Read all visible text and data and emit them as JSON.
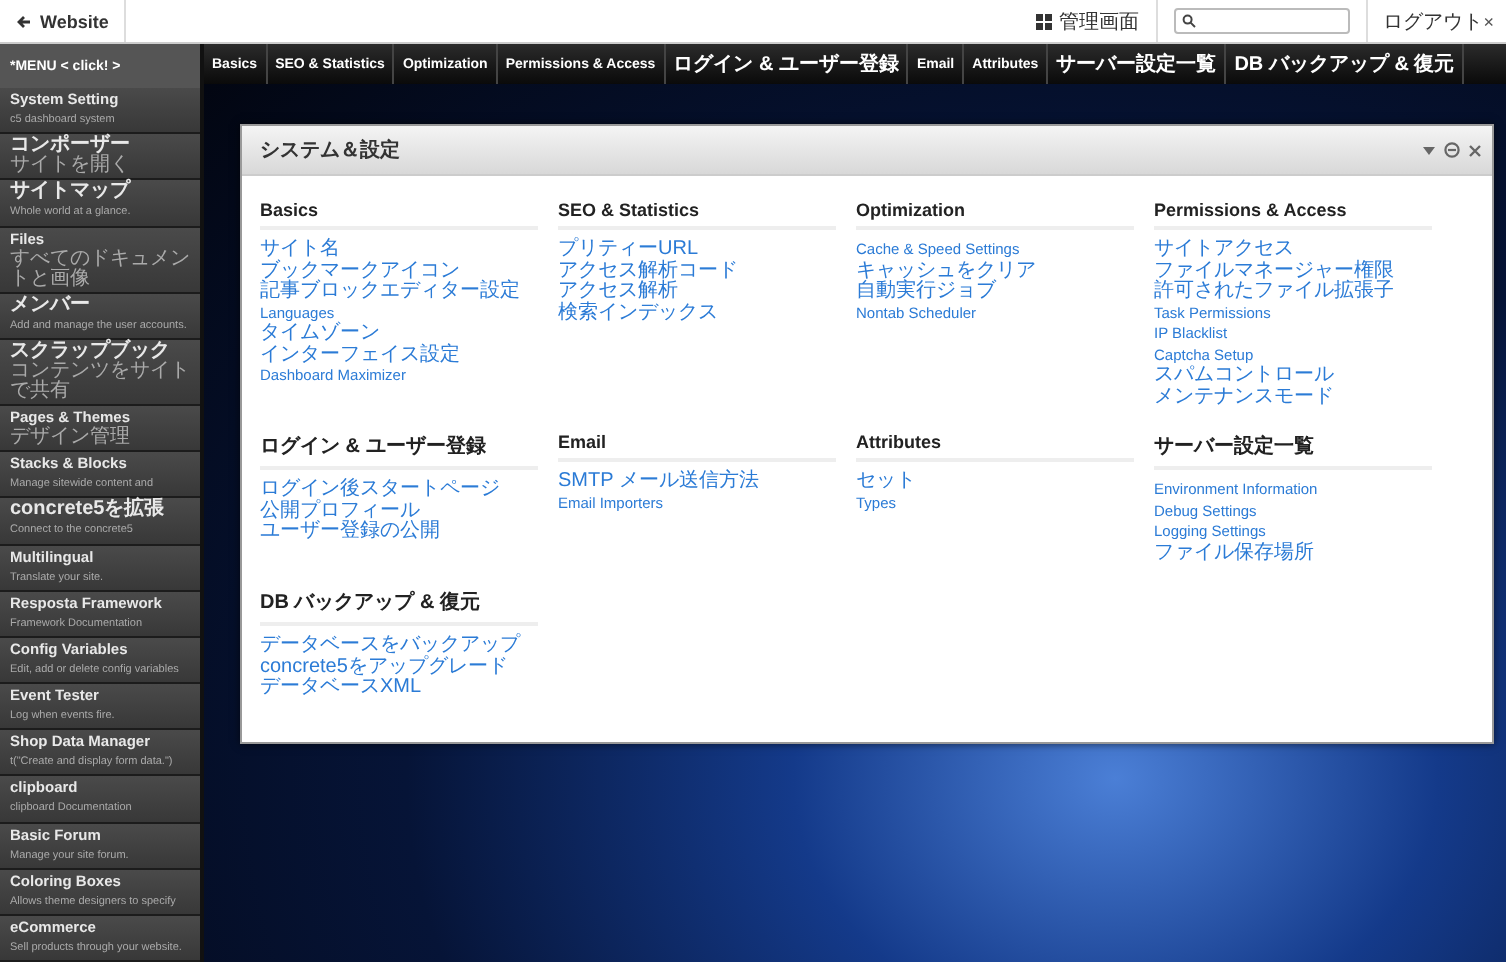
{
  "top_bar": {
    "back_link": "Website",
    "admin_link": "管理画面",
    "logout_link": "ログアウト",
    "logout_mark": "×"
  },
  "sidebar": {
    "menu_button": "*MENU < click! >",
    "items": [
      {
        "title": "System Setting",
        "subtitle": "c5 dashboard system"
      },
      {
        "title": "コンポーザー",
        "subtitle": "サイトを開く"
      },
      {
        "title": "サイトマップ",
        "subtitle": "Whole world at a glance."
      },
      {
        "title": "Files",
        "subtitle": "すべてのドキュメントと画像"
      },
      {
        "title": "メンバー",
        "subtitle": "Add and manage the user accounts."
      },
      {
        "title": "スクラップブック",
        "subtitle": "コンテンツをサイトで共有"
      },
      {
        "title": "Pages & Themes",
        "subtitle": "デザイン管理"
      },
      {
        "title": "Stacks & Blocks",
        "subtitle": "Manage sitewide content and"
      },
      {
        "title": "concrete5を拡張",
        "subtitle": "Connect to the concrete5"
      },
      {
        "title": "Multilingual",
        "subtitle": "Translate your site."
      },
      {
        "title": "Resposta Framework",
        "subtitle": "Framework Documentation"
      },
      {
        "title": "Config Variables",
        "subtitle": "Edit, add or delete config variables"
      },
      {
        "title": "Event Tester",
        "subtitle": "Log when events fire."
      },
      {
        "title": "Shop Data Manager",
        "subtitle": "t(\"Create and display form data.\")"
      },
      {
        "title": "clipboard",
        "subtitle": "clipboard Documentation"
      },
      {
        "title": "Basic Forum",
        "subtitle": "Manage your site forum."
      },
      {
        "title": "Coloring Boxes",
        "subtitle": "Allows theme designers to specify"
      },
      {
        "title": "eCommerce",
        "subtitle": "Sell products through your website."
      }
    ]
  },
  "nav_tabs": [
    "Basics",
    "SEO & Statistics",
    "Optimization",
    "Permissions & Access",
    "ログイン & ユーザー登録",
    "Email",
    "Attributes",
    "サーバー設定一覧",
    "DB バックアップ & 復元"
  ],
  "panel": {
    "title": "システム＆設定",
    "sections": [
      {
        "heading": "Basics",
        "links": [
          "サイト名",
          "ブックマークアイコン",
          "記事ブロックエディター設定",
          "Languages",
          "タイムゾーン",
          "インターフェイス設定",
          "Dashboard Maximizer"
        ]
      },
      {
        "heading": "SEO & Statistics",
        "links": [
          "プリティーURL",
          "アクセス解析コード",
          "アクセス解析",
          "検索インデックス"
        ]
      },
      {
        "heading": "Optimization",
        "links": [
          "Cache & Speed Settings",
          "キャッシュをクリア",
          "自動実行ジョブ",
          "Nontab Scheduler"
        ]
      },
      {
        "heading": "Permissions & Access",
        "links": [
          "サイトアクセス",
          "ファイルマネージャー権限",
          "許可されたファイル拡張子",
          "Task Permissions",
          "IP Blacklist",
          "Captcha Setup",
          "スパムコントロール",
          "メンテナンスモード"
        ]
      },
      {
        "heading": "ログイン & ユーザー登録",
        "links": [
          "ログイン後スタートページ",
          "公開プロフィール",
          "ユーザー登録の公開"
        ]
      },
      {
        "heading": "Email",
        "links": [
          "SMTP メール送信方法",
          "Email Importers"
        ]
      },
      {
        "heading": "Attributes",
        "links": [
          "セット",
          "Types"
        ]
      },
      {
        "heading": "サーバー設定一覧",
        "links": [
          "Environment Information",
          "Debug Settings",
          "Logging Settings",
          "ファイル保存場所"
        ]
      },
      {
        "heading": "DB バックアップ & 復元",
        "links": [
          "データベースをバックアップ",
          "concrete5をアップグレード",
          "データベースXML"
        ]
      }
    ]
  }
}
